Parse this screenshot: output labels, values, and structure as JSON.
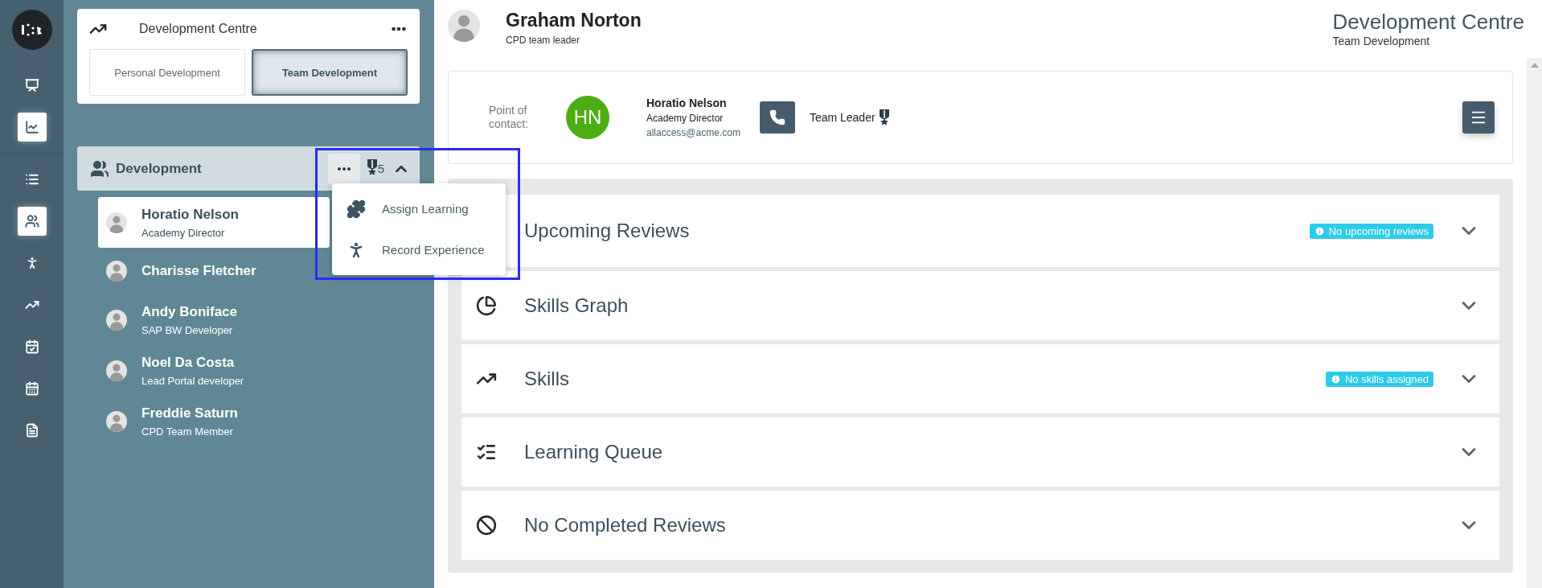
{
  "rail": {
    "items": [
      {
        "kind": "presentation",
        "selected": false
      },
      {
        "kind": "chart",
        "selected": true
      },
      {
        "kind": "list",
        "selected": false
      },
      {
        "kind": "group",
        "selected": true
      },
      {
        "kind": "person",
        "selected": false
      },
      {
        "kind": "trend",
        "selected": false
      },
      {
        "kind": "calendar",
        "selected": false
      },
      {
        "kind": "calendar-grid",
        "selected": false
      },
      {
        "kind": "document",
        "selected": false
      }
    ]
  },
  "centre_card": {
    "title": "Development Centre",
    "tabs": [
      {
        "label": "Personal Development",
        "selected": false
      },
      {
        "label": "Team Development",
        "selected": true
      }
    ]
  },
  "team": {
    "title": "Development",
    "badge_count": "5",
    "expanded": true,
    "menu": [
      {
        "kind": "puzzle",
        "label": "Assign Learning"
      },
      {
        "kind": "person",
        "label": "Record Experience"
      }
    ],
    "members": [
      {
        "name": "Horatio Nelson",
        "role": "Academy Director",
        "selected": true
      },
      {
        "name": "Charisse Fletcher",
        "selected": false
      },
      {
        "name": "Andy Boniface",
        "role": "SAP BW Developer",
        "selected": false
      },
      {
        "name": "Noel Da Costa",
        "role": "Lead Portal developer",
        "selected": false
      },
      {
        "name": "Freddie Saturn",
        "role": "CPD Team Member",
        "selected": false
      }
    ]
  },
  "highlight": {
    "kind": "frame"
  },
  "header": {
    "name": "Graham Norton",
    "role": "CPD team leader",
    "title": "Development Centre",
    "subtitle": "Team Development"
  },
  "contact": {
    "label": "Point of contact:",
    "initials": "HN",
    "name": "Horatio Nelson",
    "role": "Academy Director",
    "email": "allaccess@acme.com",
    "position": "Team Leader"
  },
  "sections": [
    {
      "kind": "none",
      "title": "Upcoming Reviews",
      "badge": "No upcoming reviews"
    },
    {
      "kind": "pie",
      "title": "Skills Graph"
    },
    {
      "kind": "trend",
      "title": "Skills",
      "badge": "No skills assigned"
    },
    {
      "kind": "queue",
      "title": "Learning Queue"
    },
    {
      "kind": "blocked",
      "title": "No Completed Reviews"
    }
  ]
}
